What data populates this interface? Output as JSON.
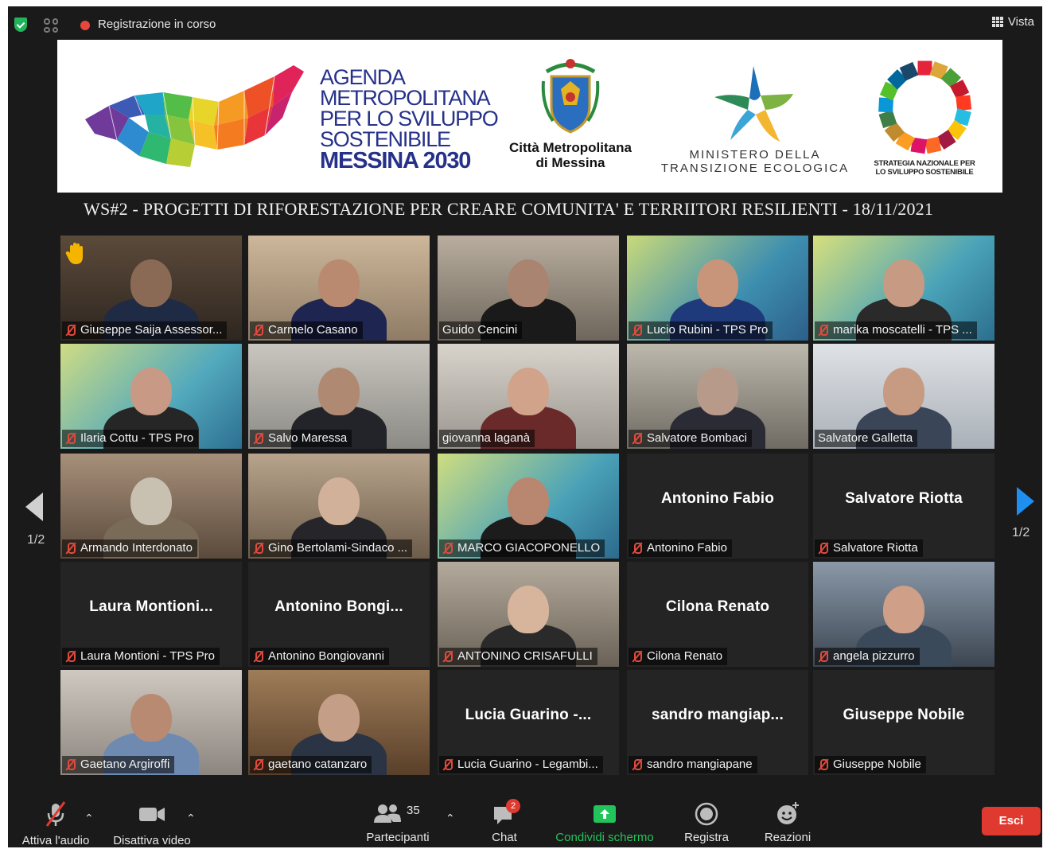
{
  "topbar": {
    "recording_text": "Registrazione in corso",
    "view_label": "Vista"
  },
  "banner": {
    "agenda_lines": [
      "AGENDA",
      "METROPOLITANA",
      "PER LO SVILUPPO",
      "SOSTENIBILE"
    ],
    "agenda_bold": "MESSINA 2030",
    "citta_line1": "Città Metropolitana",
    "citta_line2": "di Messina",
    "ministero_line1": "MINISTERO DELLA",
    "ministero_line2": "TRANSIZIONE ECOLOGICA",
    "strategia_line1": "STRATEGIA NAZIONALE PER",
    "strategia_line2": "LO SVILUPPO SOSTENIBILE"
  },
  "meeting_title": "WS#2 - PROGETTI DI RIFORESTAZIONE PER CREARE COMUNITA' E TERRIITORI RESILIENTI - 18/11/2021",
  "participants": [
    {
      "label": "Giuseppe Saija Assessor...",
      "muted": true,
      "hand_raised": true
    },
    {
      "label": "Carmelo Casano",
      "muted": true
    },
    {
      "label": "Guido Cencini",
      "muted": false
    },
    {
      "label": "Lucio Rubini - TPS Pro",
      "muted": true
    },
    {
      "label": "marika moscatelli - TPS ...",
      "muted": true
    },
    {
      "label": "Ilaria Cottu - TPS Pro",
      "muted": true
    },
    {
      "label": "Salvo Maressa",
      "muted": true
    },
    {
      "label": "giovanna laganà",
      "muted": false
    },
    {
      "label": "Salvatore Bombaci",
      "muted": true
    },
    {
      "label": "Salvatore Galletta",
      "muted": false,
      "active_speaker": true
    },
    {
      "label": "Armando Interdonato",
      "muted": true
    },
    {
      "label": "Gino Bertolami-Sindaco ...",
      "muted": true
    },
    {
      "label": "MARCO GIACOPONELLO",
      "muted": true
    },
    {
      "label": "Antonino Fabio",
      "display": "Antonino Fabio",
      "muted": true
    },
    {
      "label": "Salvatore  Riotta",
      "display": "Salvatore  Riotta",
      "muted": true
    },
    {
      "label": "Laura Montioni - TPS Pro",
      "display": "Laura  Montioni...",
      "muted": true
    },
    {
      "label": "Antonino Bongiovanni",
      "display": "Antonino  Bongi...",
      "muted": true
    },
    {
      "label": "ANTONINO CRISAFULLI",
      "muted": true
    },
    {
      "label": "Cilona Renato",
      "display": "Cilona Renato",
      "muted": true
    },
    {
      "label": "angela pizzurro",
      "muted": true
    },
    {
      "label": "Gaetano Argiroffi",
      "muted": true
    },
    {
      "label": "gaetano catanzaro",
      "muted": true
    },
    {
      "label": "Lucia Guarino - Legambi...",
      "display": "Lucia Guarino -...",
      "muted": true
    },
    {
      "label": "sandro mangiapane",
      "display": "sandro  mangiap...",
      "muted": true
    },
    {
      "label": "Giuseppe Nobile",
      "display": "Giuseppe Nobile",
      "muted": true
    }
  ],
  "pagination": {
    "left": "1/2",
    "right": "1/2"
  },
  "toolbar": {
    "audio_label": "Attiva l'audio",
    "video_label": "Disattiva video",
    "participants_label": "Partecipanti",
    "participants_count": "35",
    "chat_label": "Chat",
    "chat_badge": "2",
    "share_label": "Condividi schermo",
    "record_label": "Registra",
    "reactions_label": "Reazioni",
    "leave_label": "Esci"
  },
  "colors": {
    "background": "#1a1a1a",
    "active_speaker_border": "#b9d34b",
    "share_green": "#23c35b",
    "leave_red": "#e0392f",
    "nav_arrow_blue": "#1e8ff0",
    "agenda_blue": "#26318a"
  }
}
